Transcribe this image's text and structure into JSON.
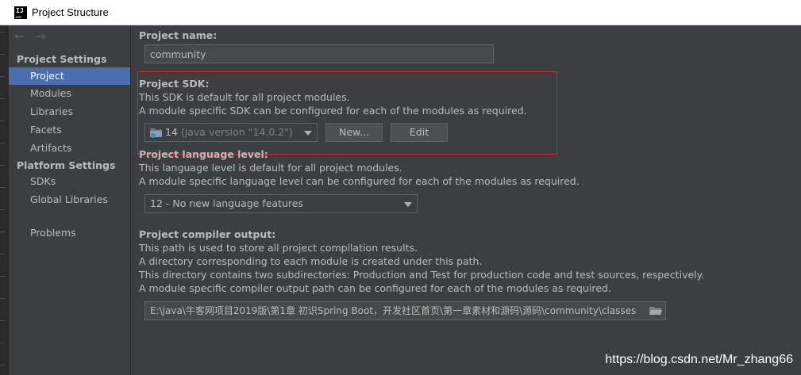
{
  "window": {
    "title": "Project Structure",
    "icon_text": "IJ"
  },
  "sidebar": {
    "nav_back": "←",
    "nav_forward": "→",
    "project_settings_title": "Project Settings",
    "project_settings_items": [
      "Project",
      "Modules",
      "Libraries",
      "Facets",
      "Artifacts"
    ],
    "selected": "Project",
    "platform_settings_title": "Platform Settings",
    "platform_settings_items": [
      "SDKs",
      "Global Libraries"
    ],
    "problems": "Problems"
  },
  "project_name": {
    "label": "Project name:",
    "value": "community"
  },
  "project_sdk": {
    "label": "Project SDK:",
    "desc_1": "This SDK is default for all project modules.",
    "desc_2": "A module specific SDK can be configured for each of the modules as required.",
    "selected_name": "14",
    "selected_version": "(java version \"14.0.2\")",
    "new_button": "New...",
    "edit_button": "Edit"
  },
  "language_level": {
    "label": "Project language level:",
    "desc_1": "This language level is default for all project modules.",
    "desc_2": "A module specific language level can be configured for each of the modules as required.",
    "selected": "12 - No new language features"
  },
  "compiler_output": {
    "label": "Project compiler output:",
    "desc_1": "This path is used to store all project compilation results.",
    "desc_2": "A directory corresponding to each module is created under this path.",
    "desc_3": "This directory contains two subdirectories: Production and Test for production code and test sources, respectively.",
    "desc_4": "A module specific compiler output path can be configured for each of the modules as required.",
    "path": "E:\\java\\牛客网项目2019版\\第1章 初识Spring Boot，开发社区首页\\第一章素材和源码\\源码\\community\\classes"
  },
  "watermark": "https://blog.csdn.net/Mr_zhang66",
  "colors": {
    "background": "#3c3f41",
    "selection": "#4b6eaf",
    "highlight_box": "#d9242b"
  }
}
